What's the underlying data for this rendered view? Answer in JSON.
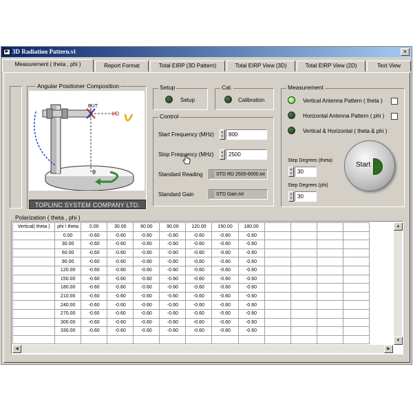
{
  "window": {
    "title": "3D Radiation Pattern.vi",
    "icon_text": "▶",
    "close_label": "×"
  },
  "tabs": [
    {
      "label": "Measurement ( theta , phi )"
    },
    {
      "label": "Report Format"
    },
    {
      "label": "Total EIRP (3D Pattern)"
    },
    {
      "label": "Total EIRP View (3D)"
    },
    {
      "label": "Total EIRP View (2D)"
    },
    {
      "label": "Text View"
    }
  ],
  "positioner": {
    "title": "Angular Positioner Composition",
    "eut_label": "EUT",
    "theta_label": "θ",
    "phi_label": "φ",
    "company": "TOPLINC SYSTEM COMPANY LTD."
  },
  "setup": {
    "title": "Setup",
    "button_label": "Setup"
  },
  "cal": {
    "title": "Cal.",
    "button_label": "Calibration"
  },
  "control": {
    "title": "Control",
    "start_freq_label": "Start Frequency (MHz)",
    "start_freq_value": "800",
    "stop_freq_label": "Stop Frequency (MHz)",
    "stop_freq_value": "2500",
    "std_reading_label": "Standard Reading",
    "std_reading_file": "STD RD 2500-6000.txt",
    "std_gain_label": "Standard Gain",
    "std_gain_file": "STD Gain.txt"
  },
  "measurement": {
    "title": "Measurement",
    "options": [
      {
        "label": "Vertical Antenna Pattern ( theta )",
        "active": true
      },
      {
        "label": "Horizontal Antenna Pattern ( phi )",
        "active": false
      },
      {
        "label": "Vertical & Horizontal ( theta & phi )",
        "active": false
      }
    ],
    "step_theta_label": "Step Degrees (theta)",
    "step_theta_value": "30",
    "step_phi_label": "Step Degrees (phi)",
    "step_phi_value": "30",
    "start_label": "Start"
  },
  "polarization": {
    "title": "Polarization  ( theta , phi )",
    "corner_label": "Vertical( theta )",
    "row_header_label": "phi \\ theta",
    "columns": [
      "0.00",
      "30.00",
      "60.00",
      "90.00",
      "120.00",
      "150.00",
      "180.00"
    ],
    "rows": [
      {
        "phi": "0.00",
        "values": [
          "-0.60",
          "-0.60",
          "-0.60",
          "-0.60",
          "-0.60",
          "-0.60",
          "-0.60"
        ]
      },
      {
        "phi": "30.00",
        "values": [
          "-0.60",
          "-0.60",
          "-0.60",
          "-0.60",
          "-0.60",
          "-0.60",
          "-0.60"
        ]
      },
      {
        "phi": "60.00",
        "values": [
          "-0.60",
          "-0.60",
          "-0.60",
          "-0.60",
          "-0.60",
          "-0.60",
          "-0.60"
        ]
      },
      {
        "phi": "90.00",
        "values": [
          "-0.60",
          "-0.60",
          "-0.60",
          "-0.60",
          "-0.60",
          "-0.60",
          "-0.60"
        ]
      },
      {
        "phi": "120.00",
        "values": [
          "-0.60",
          "-0.60",
          "-0.60",
          "-0.60",
          "-0.60",
          "-0.60",
          "-0.60"
        ]
      },
      {
        "phi": "150.00",
        "values": [
          "-0.60",
          "-0.60",
          "-0.60",
          "-0.60",
          "-0.60",
          "-0.60",
          "-0.60"
        ]
      },
      {
        "phi": "180.00",
        "values": [
          "-0.60",
          "-0.60",
          "-0.60",
          "-0.60",
          "-0.60",
          "-0.60",
          "-0.60"
        ]
      },
      {
        "phi": "210.00",
        "values": [
          "-0.60",
          "-0.60",
          "-0.60",
          "-0.60",
          "-0.60",
          "-0.60",
          "-0.60"
        ]
      },
      {
        "phi": "240.00",
        "values": [
          "-0.60",
          "-0.60",
          "-0.60",
          "-0.60",
          "-0.60",
          "-0.60",
          "-0.60"
        ]
      },
      {
        "phi": "270.00",
        "values": [
          "-0.60",
          "-0.60",
          "-0.60",
          "-0.60",
          "-0.60",
          "-0.60",
          "-0.60"
        ]
      },
      {
        "phi": "300.00",
        "values": [
          "-0.60",
          "-0.60",
          "-0.60",
          "-0.60",
          "-0.60",
          "-0.60",
          "-0.60"
        ]
      },
      {
        "phi": "330.00",
        "values": [
          "-0.60",
          "-0.60",
          "-0.60",
          "-0.60",
          "-0.60",
          "-0.60",
          "-0.60"
        ]
      }
    ]
  },
  "colors": {
    "title_bar": "#0a246a",
    "led_on": "#40d020",
    "led_off": "#1c4a1c",
    "start_indicator": "#2e6d1f"
  }
}
